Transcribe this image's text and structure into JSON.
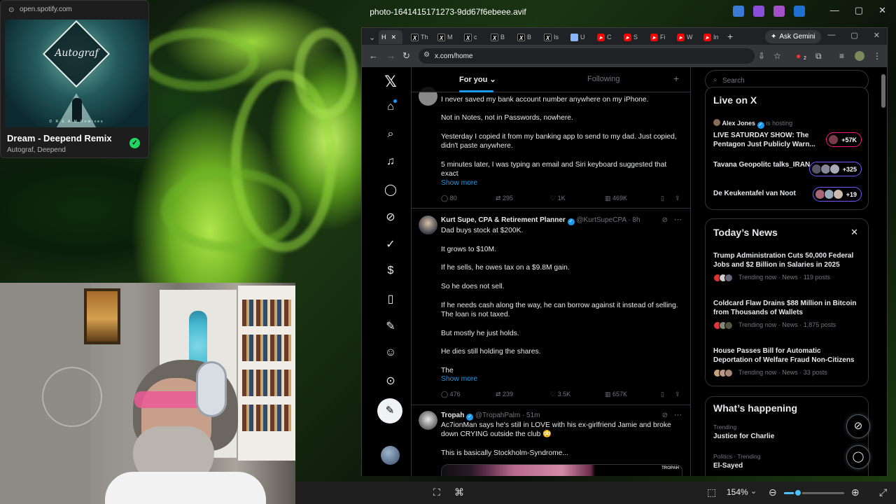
{
  "viewer": {
    "title": "photo-1641415171273-9dd67f6ebeee.avif",
    "zoom": "154%"
  },
  "spotify": {
    "url": "open.spotify.com",
    "track": "Dream - Deepend Remix",
    "artist": "Autograf, Deepend",
    "cover_text": "Autograf",
    "cover_caption": "D R E A M  Remixes"
  },
  "browser": {
    "tabs": [
      "H",
      "Th",
      "M",
      "c",
      "B",
      "B",
      "Is",
      "U",
      "C",
      "S",
      "Fi",
      "W",
      "In"
    ],
    "ask_gemini": "Ask Gemini",
    "url": "x.com/home",
    "ext_badge": "2"
  },
  "x": {
    "tabs": {
      "for_you": "For you",
      "following": "Following"
    },
    "search_placeholder": "Search",
    "tweets": [
      {
        "text": [
          "I never saved my bank account number anywhere on my iPhone.",
          "Not in Notes, not in Passwords, nowhere.",
          "Yesterday I copied it from my banking app to send to my dad. Just copied, didn't paste anywhere.",
          "5 minutes later, I was typing an email and Siri keyboard suggested that exact"
        ],
        "show_more": "Show more",
        "replies": "80",
        "reposts": "295",
        "likes": "1K",
        "views": "469K"
      },
      {
        "name": "Kurt Supe, CPA & Retirement Planner",
        "handle": "@KurtSupeCPA",
        "time": "· 8h",
        "text": [
          "Dad buys stock at $200K.",
          "It grows to $10M.",
          "If he sells, he owes tax on a $9.8M gain.",
          "So he does not sell.",
          "If he needs cash along the way, he can borrow against it instead of selling. The loan is not taxed.",
          "But mostly he just holds.",
          "He dies still holding the shares.",
          "The"
        ],
        "show_more": "Show more",
        "replies": "476",
        "reposts": "239",
        "likes": "3.5K",
        "views": "657K"
      },
      {
        "name": "Tropah",
        "handle": "@TropahPalm",
        "time": "· 51m",
        "text": [
          "Ac7ionMan says he's still in LOVE with his ex-girlfriend Jamie and broke down CRYING outside the club 😳",
          "This is basically Stockholm-Syndrome..."
        ],
        "media_watermark": "TROPAH"
      }
    ],
    "live": {
      "title": "Live on X",
      "spaces": [
        {
          "host": "Alex Jones",
          "host_suffix": "is hosting",
          "title": "LIVE SATURDAY SHOW: The Pentagon Just Publicly Warn...",
          "count": "+57K"
        },
        {
          "title": "Tavana Geopolitc talks_IRAN",
          "count": "+325"
        },
        {
          "title": "De Keukentafel van Noot",
          "count": "+19"
        }
      ]
    },
    "news": {
      "title": "Today’s News",
      "items": [
        {
          "headline": "Trump Administration Cuts 50,000 Federal Jobs and $2 Billion in Salaries in 2025",
          "meta": "Trending now · News · 119 posts"
        },
        {
          "headline": "Coldcard Flaw Drains $88 Million in Bitcoin from Thousands of Wallets",
          "meta": "Trending now · News · 1,875 posts"
        },
        {
          "headline": "House Passes Bill for Automatic Deportation of Welfare Fraud Non-Citizens",
          "meta": "Trending now · News · 33 posts"
        }
      ]
    },
    "happening": {
      "title": "What’s happening",
      "trends": [
        {
          "context": "Trending",
          "name": "Justice for Charlie"
        },
        {
          "context": "Politics · Trending",
          "name": "El-Sayed"
        }
      ]
    }
  }
}
